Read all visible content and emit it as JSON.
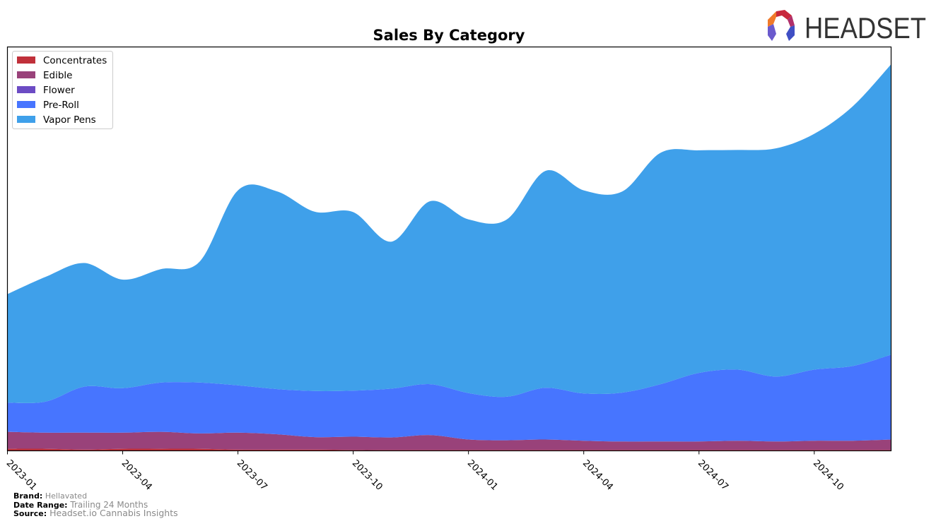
{
  "brand_logo": {
    "text": "HEADSET",
    "icon": "headset-logo-icon"
  },
  "footer": {
    "brand_label": "Brand:",
    "brand_value": "Hellavated",
    "date_range_label": "Date Range:",
    "date_range_value": "Trailing 24 Months",
    "source_label": "Source:",
    "source_value": "Headset.io Cannabis Insights"
  },
  "chart_data": {
    "type": "area",
    "stacked": true,
    "smooth": true,
    "title": "Sales By Category",
    "xlabel": "",
    "ylabel": "",
    "y_axis_visible": false,
    "grid": false,
    "legend_position": "top-left",
    "x": [
      "2023-01",
      "2023-02",
      "2023-03",
      "2023-04",
      "2023-05",
      "2023-06",
      "2023-07",
      "2023-08",
      "2023-09",
      "2023-10",
      "2023-11",
      "2023-12",
      "2024-01",
      "2024-02",
      "2024-03",
      "2024-04",
      "2024-05",
      "2024-06",
      "2024-07",
      "2024-08",
      "2024-09",
      "2024-10",
      "2024-11",
      "2024-12"
    ],
    "x_ticks": [
      "2023-01",
      "2023-04",
      "2023-07",
      "2023-10",
      "2024-01",
      "2024-04",
      "2024-07",
      "2024-10"
    ],
    "ylim": [
      0,
      100
    ],
    "series": [
      {
        "name": "Concentrates",
        "color": "#c0303a",
        "values": [
          0.5,
          0.5,
          0.3,
          0.5,
          0.5,
          0.5,
          0.3,
          0.3,
          0.3,
          0.2,
          0.2,
          0.2,
          0.2,
          0.2,
          0.2,
          0.2,
          0.2,
          0.2,
          0.2,
          0.2,
          0.2,
          0.2,
          0.2,
          0.2
        ]
      },
      {
        "name": "Edible",
        "color": "#99427a",
        "values": [
          4.2,
          4.0,
          4.2,
          4.0,
          4.2,
          3.8,
          4.2,
          3.8,
          3.1,
          3.3,
          3.1,
          3.7,
          2.6,
          2.4,
          2.6,
          2.3,
          2.1,
          2.1,
          2.1,
          2.3,
          2.1,
          2.3,
          2.3,
          2.6
        ]
      },
      {
        "name": "Flower",
        "color": "#6c4cc4",
        "values": [
          0,
          0,
          0,
          0,
          0,
          0,
          0,
          0,
          0,
          0,
          0,
          0,
          0,
          0,
          0,
          0,
          0,
          0,
          0,
          0,
          0,
          0,
          0,
          0
        ]
      },
      {
        "name": "Pre-Roll",
        "color": "#4775ff",
        "values": [
          7.2,
          7.7,
          11.4,
          11.0,
          12.2,
          12.6,
          11.7,
          11.2,
          11.4,
          11.4,
          12.1,
          12.6,
          11.5,
          10.8,
          12.8,
          11.7,
          12.1,
          14.2,
          17.0,
          17.6,
          16.1,
          17.6,
          18.5,
          21.0
        ]
      },
      {
        "name": "Vapor Pens",
        "color": "#3fa0ea",
        "values": [
          26.9,
          30.9,
          30.6,
          26.9,
          28.1,
          29.9,
          48.3,
          49.0,
          44.4,
          44.2,
          36.4,
          45.3,
          43.0,
          43.9,
          53.7,
          50.3,
          49.8,
          57.3,
          55.1,
          54.4,
          56.5,
          58.4,
          64.3,
          71.9
        ]
      }
    ]
  }
}
